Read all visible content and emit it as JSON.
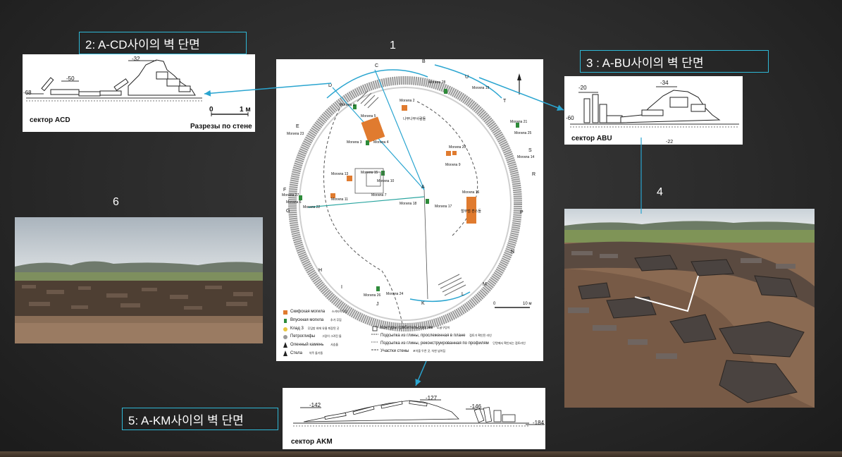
{
  "slide": {
    "figure_numbers": {
      "n1": "1",
      "n4": "4",
      "n6": "6"
    },
    "captions": {
      "c2": "2: A-CD사이의 벽 단면",
      "c3": "3 : A-BU사이의 벽 단면",
      "c5": "5: A-KM사이의 벽 단면"
    },
    "panels": {
      "acd": {
        "sector": "сектор ACD",
        "scale_0": "0",
        "scale_1": "1 м",
        "note": "Разрезы по стене",
        "lv_left": "-68",
        "lv_top": "-32",
        "lv_mid": "-50"
      },
      "abu": {
        "sector": "сектор ABU",
        "lv_a": "-20",
        "lv_b": "-34",
        "lv_c": "-60",
        "lv_d": "-22"
      },
      "akm": {
        "sector": "сектор AKM",
        "lv_a": "-142",
        "lv_b": "-127",
        "lv_c": "-146",
        "lv_d": "-184"
      }
    },
    "map": {
      "letters": {
        "B": "B",
        "C": "C",
        "D": "D",
        "E": "E",
        "F": "F",
        "G": "G",
        "H": "H",
        "I": "I",
        "J": "J",
        "K": "K",
        "L": "L",
        "M": "M",
        "N": "N",
        "P": "P",
        "R": "R",
        "S": "S",
        "T": "T",
        "U": "U",
        "A": "A"
      },
      "graves": {
        "m1": "Могила 1",
        "m2": "Могила 2",
        "m3": "Могила 3",
        "m4": "Могила 4",
        "m5": "Могила 5",
        "m6": "Могила 6",
        "m7": "Могила 7",
        "m8": "Могила 8",
        "m9": "Могила 9",
        "m10": "Могила 10",
        "m11": "Могила 11",
        "m13": "Могила 13",
        "m14": "Могила 14",
        "m15": "Могила 15",
        "m16": "Могила 16",
        "m17": "Могила 17",
        "m18": "Могила 18",
        "m19": "Могила 19",
        "m20": "Могила 20",
        "m21": "Могила 21",
        "m22": "Могила 22",
        "m23": "Могила 23",
        "m24": "Могила 24",
        "m25": "Могила 25",
        "m26": "Могила 26",
        "m27": "Могила 27",
        "m28": "Могила 28"
      },
      "scale_0": "0",
      "scale_10": "10 м",
      "legend": [
        {
          "ru": "Скифская могила",
          "ko": "스키타이무덤"
        },
        {
          "ru": "Впускная могила",
          "ko": "추가 무덤"
        },
        {
          "ru": "Клад 3",
          "ko": "무덤방 외에 유물 퇴장된 곳"
        },
        {
          "ru": "Петроглифы",
          "ko": "그림이 그려진 돌"
        },
        {
          "ru": "Оленный камень",
          "ko": "사슴돌"
        },
        {
          "ru": "Стела",
          "ko": "석주 돌기둥"
        }
      ],
      "legend2": [
        {
          "ru": "Контуры грабительских ям",
          "ko": "도굴구덩이"
        },
        {
          "ru": "Подсыпка из глины, прослеженная в плане",
          "ko": "점토가 확인된 라인"
        },
        {
          "ru": "Подсыпка из глины, реконструированная по профилям",
          "ko": "단면에서 확인되는 점토라인"
        },
        {
          "ru": "Участки стены",
          "ko": "포석을 두른 곳, 차한 넘어짐"
        }
      ],
      "note_rocks": "나무나무사람돌",
      "note_burial": "철무덤 흔스돌"
    }
  }
}
